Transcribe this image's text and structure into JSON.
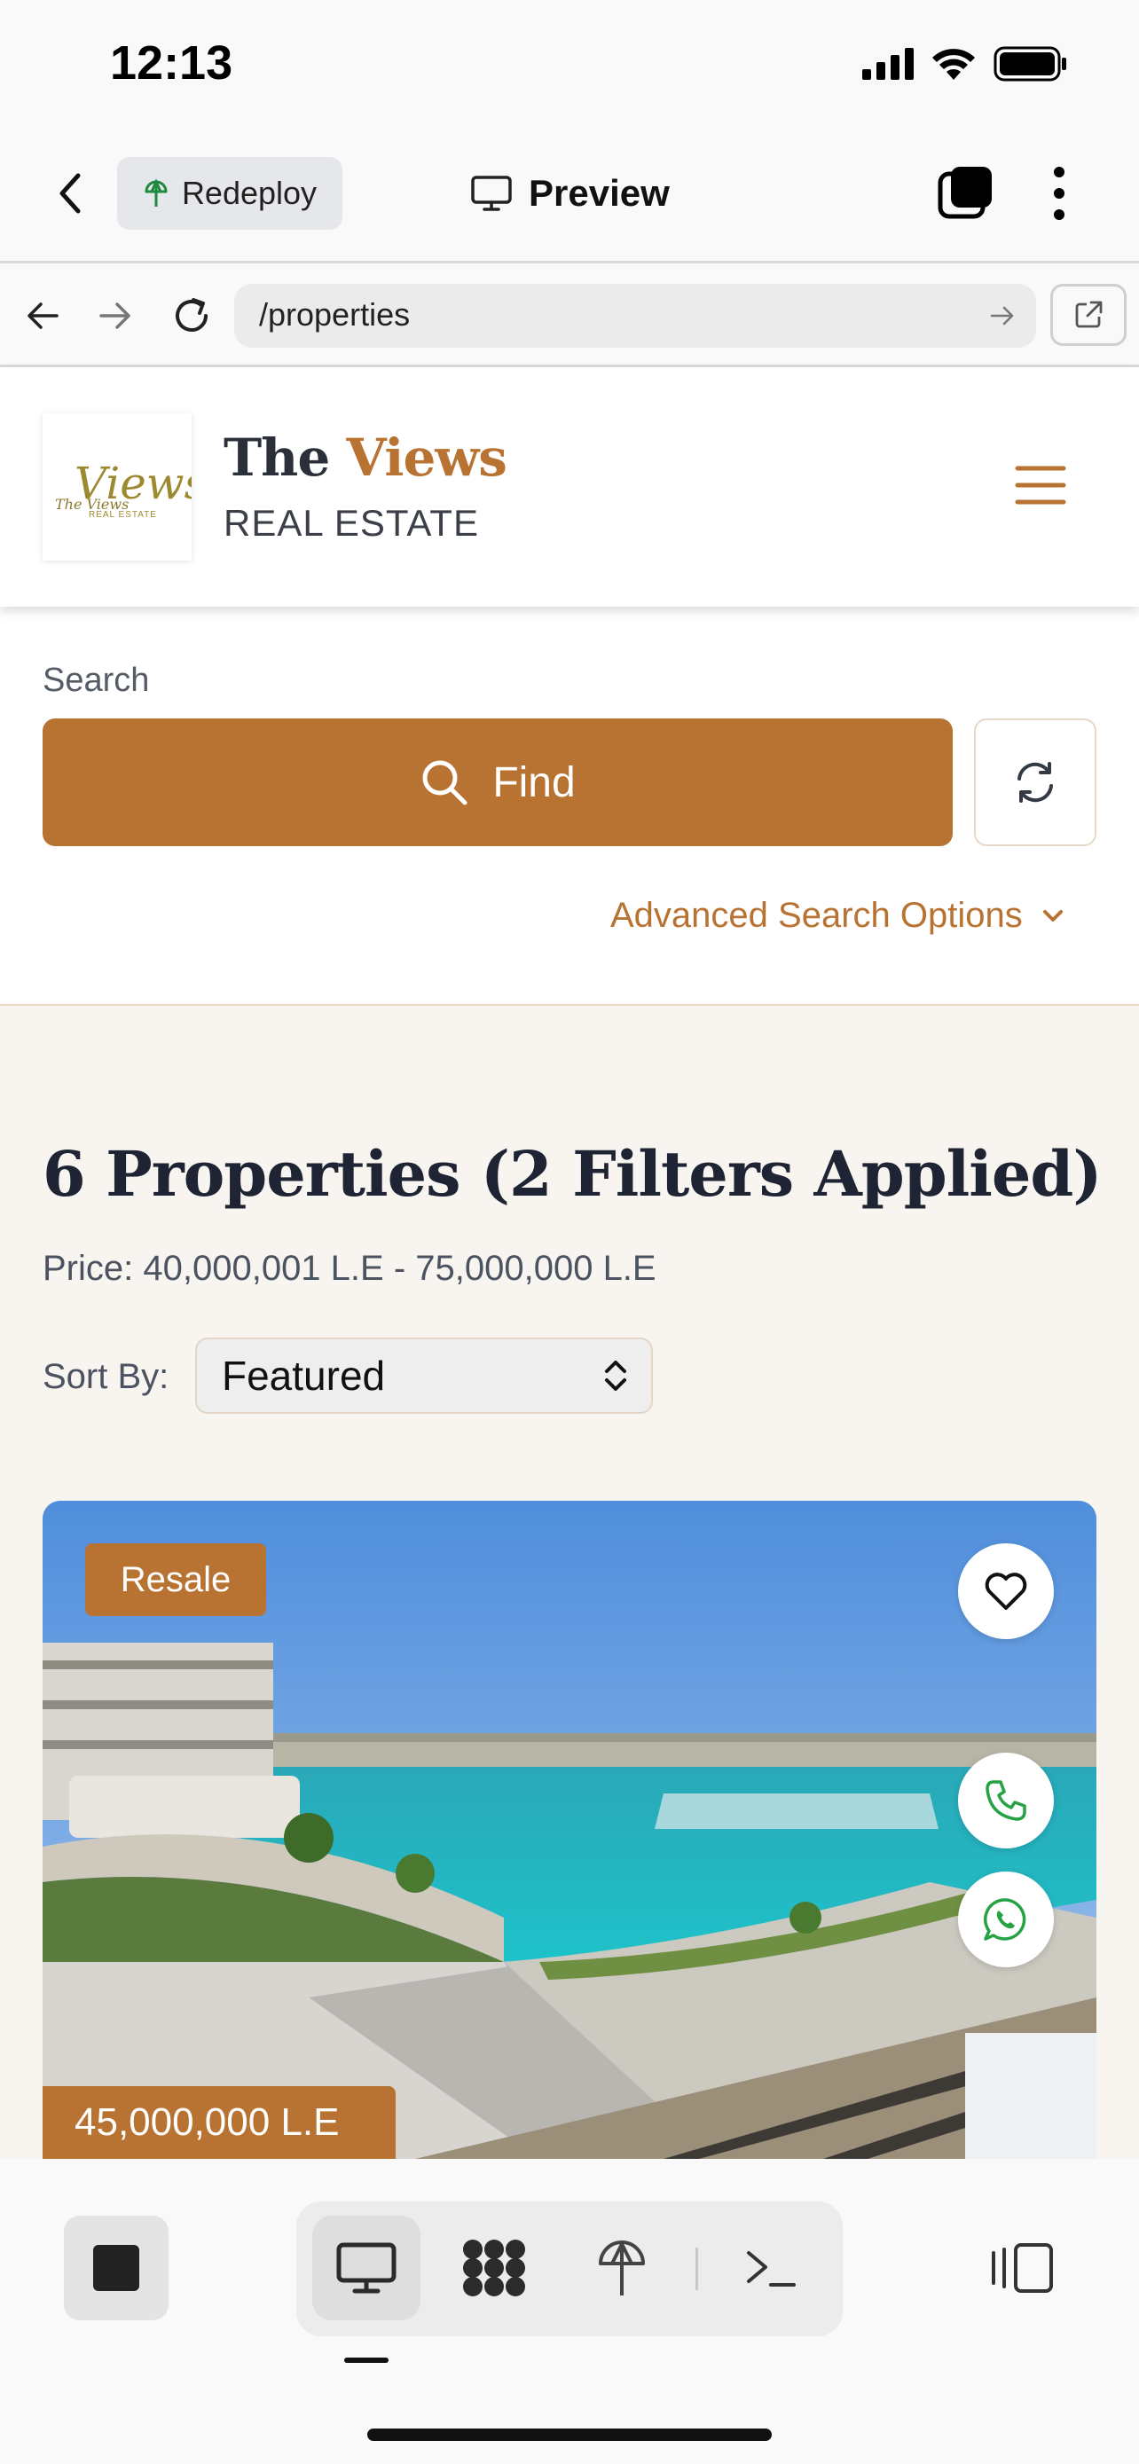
{
  "status_bar": {
    "time": "12:13"
  },
  "app_header": {
    "redeploy_label": "Redeploy",
    "preview_label": "Preview"
  },
  "browser": {
    "url": "/properties"
  },
  "site": {
    "brand_first": "The ",
    "brand_accent": "Views",
    "brand_sub": "REAL ESTATE",
    "logo_text": "The Views",
    "logo_subtext": "REAL ESTATE"
  },
  "search": {
    "label": "Search",
    "find_label": "Find",
    "advanced_label": "Advanced Search Options"
  },
  "results": {
    "title": "6 Properties (2 Filters Applied)",
    "price_filter": "Price: 40,000,001 L.E - 75,000,000 L.E",
    "sort_label": "Sort By:",
    "sort_value": "Featured"
  },
  "property": {
    "badge": "Resale",
    "price": "45,000,000 L.E"
  },
  "colors": {
    "accent": "#b87333",
    "background": "#f8f5f1",
    "whatsapp": "#25a244"
  }
}
